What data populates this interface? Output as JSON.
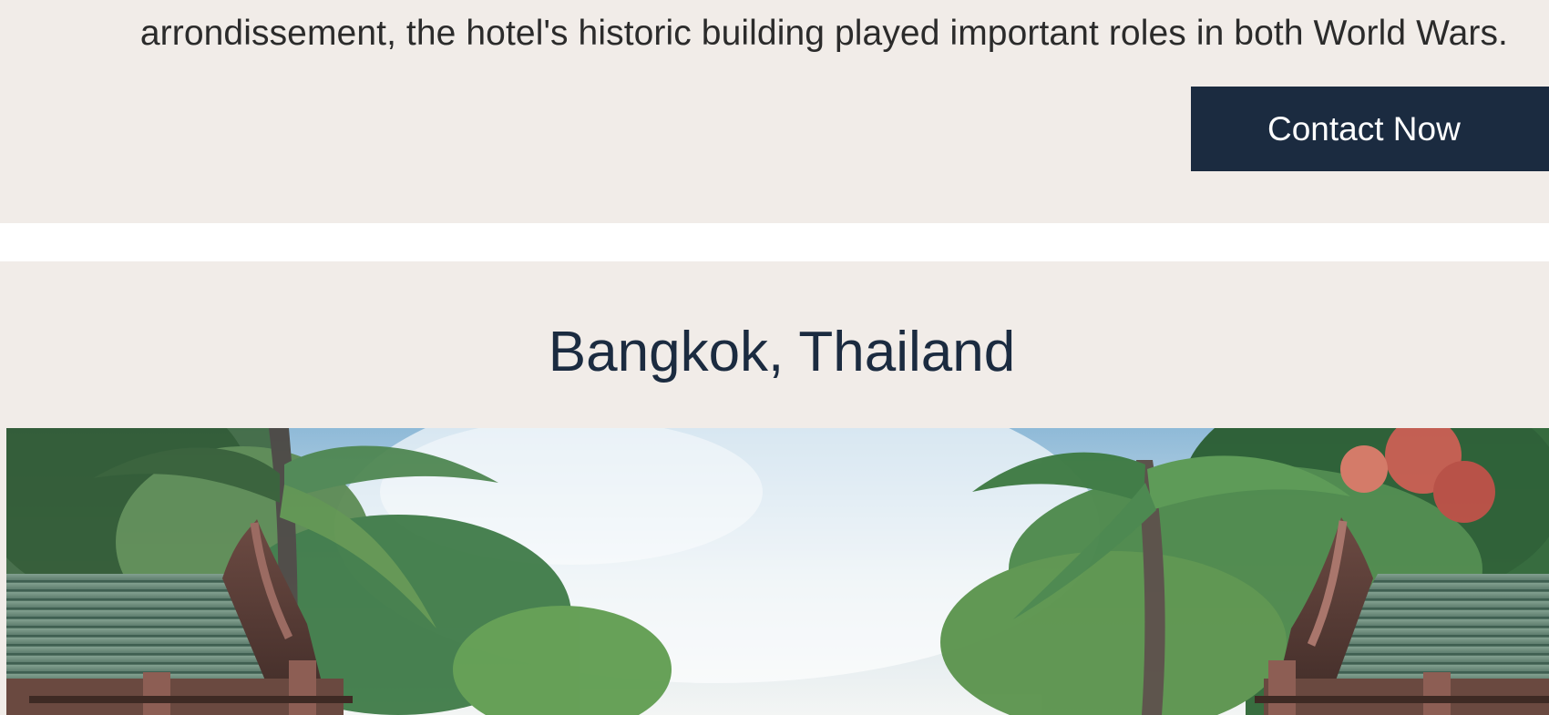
{
  "previous_hotel": {
    "description": "arrondissement, the hotel's historic building played important roles in both World Wars.",
    "contact_label": "Contact Now"
  },
  "bangkok": {
    "location": "Bangkok, Thailand",
    "image_subject": "Traditional Thai teak pavilions framed by tropical palm trees"
  },
  "colors": {
    "card_background": "#f1ece8",
    "button_navy": "#1b2b40",
    "heading_navy": "#1b2b40"
  }
}
